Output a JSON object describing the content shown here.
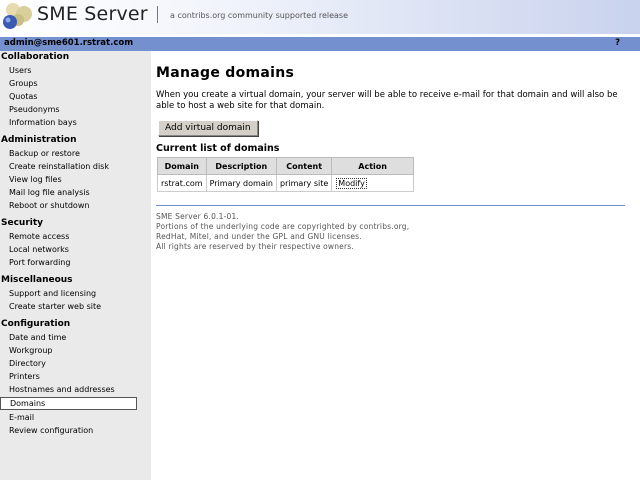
{
  "header": {
    "brand": "SME Server",
    "tagline": "a contribs.org community supported release",
    "logo_icon": "sme-logo-icon",
    "bar_color": "#7490cf"
  },
  "userbar": {
    "user": "admin@sme601.rstrat.com",
    "help": "?"
  },
  "sidebar": {
    "sections": [
      {
        "title": "Collaboration",
        "items": [
          "Users",
          "Groups",
          "Quotas",
          "Pseudonyms",
          "Information bays"
        ]
      },
      {
        "title": "Administration",
        "items": [
          "Backup or restore",
          "Create reinstallation disk",
          "View log files",
          "Mail log file analysis",
          "Reboot or shutdown"
        ]
      },
      {
        "title": "Security",
        "items": [
          "Remote access",
          "Local networks",
          "Port forwarding"
        ]
      },
      {
        "title": "Miscellaneous",
        "items": [
          "Support and licensing",
          "Create starter web site"
        ]
      },
      {
        "title": "Configuration",
        "items": [
          "Date and time",
          "Workgroup",
          "Directory",
          "Printers",
          "Hostnames and addresses",
          "Domains",
          "E-mail",
          "Review configuration"
        ]
      }
    ],
    "active": "Domains"
  },
  "main": {
    "title": "Manage domains",
    "intro": "When you create a virtual domain, your server will be able to receive e-mail for that domain and will also be able to host a web site for that domain.",
    "add_button": "Add virtual domain",
    "list_title": "Current list of domains",
    "columns": [
      "Domain",
      "Description",
      "Content",
      "Action"
    ],
    "rows": [
      {
        "domain": "rstrat.com",
        "description": "Primary domain",
        "content": "primary site",
        "action": "Modify"
      }
    ]
  },
  "footer": {
    "lines": [
      "SME Server 6.0.1-01.",
      "Portions of the underlying code are copyrighted by contribs.org,",
      "RedHat, Mitel, and under the GPL and GNU licenses.",
      "All rights are reserved by their respective owners."
    ]
  }
}
